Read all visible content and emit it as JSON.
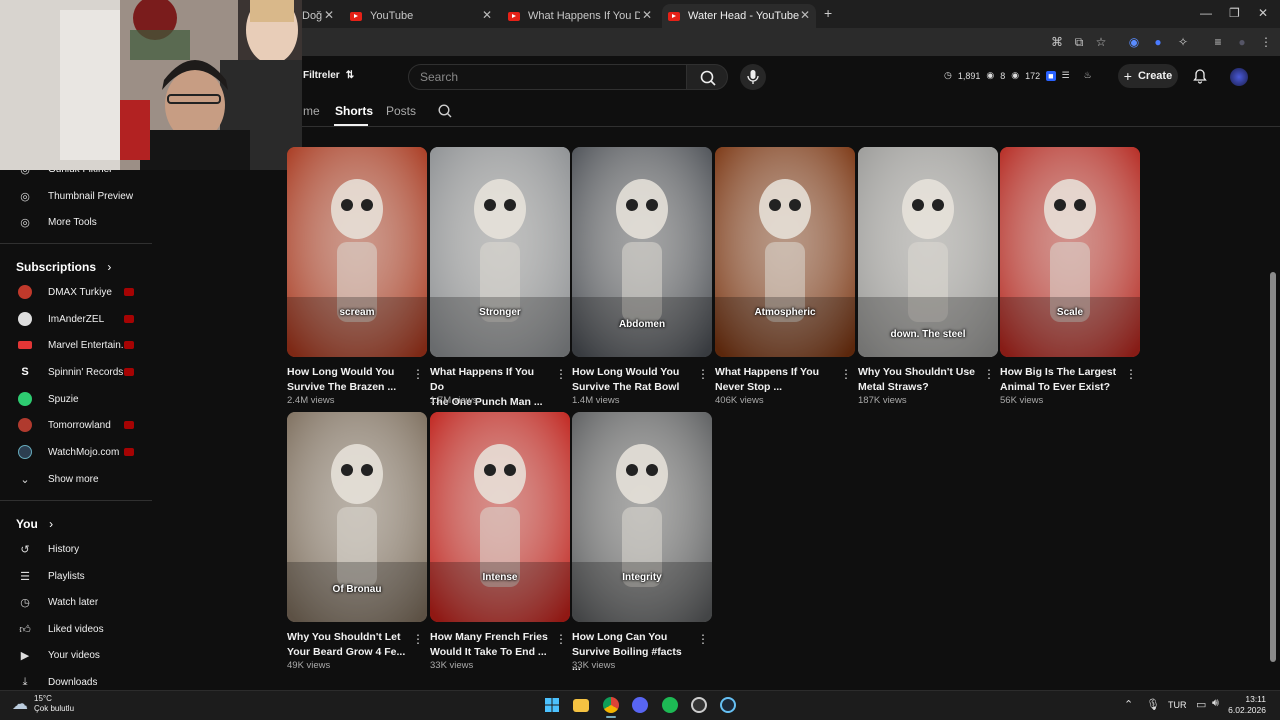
{
  "browser": {
    "tabs": [
      {
        "title": "Doğ",
        "active": false
      },
      {
        "title": "YouTube",
        "active": false
      },
      {
        "title": "What Happens If You Do The O",
        "active": false
      },
      {
        "title": "Water Head - YouTube",
        "active": true
      }
    ],
    "new_tab_icon": "plus-icon"
  },
  "header": {
    "filter_label": "Filtreler",
    "search_placeholder": "Search",
    "stats": {
      "a": "1,891",
      "b": "8",
      "c": "172"
    },
    "create_label": "Create"
  },
  "channel_tabs": [
    {
      "label": "me",
      "active": false
    },
    {
      "label": "Shorts",
      "active": true
    },
    {
      "label": "Posts",
      "active": false
    }
  ],
  "sidebar": {
    "tools": [
      {
        "label": "Günlük Fikirler",
        "icon": "tool-icon"
      },
      {
        "label": "Thumbnail Preview",
        "icon": "tool-icon"
      },
      {
        "label": "More Tools",
        "icon": "tool-icon"
      }
    ],
    "subscriptions_title": "Subscriptions",
    "subscriptions": [
      {
        "label": "DMAX Turkiye",
        "color": "#c0392b"
      },
      {
        "label": "ImAnderZEL",
        "color": "#dddddd"
      },
      {
        "label": "Marvel Entertain...",
        "color": "#e23636"
      },
      {
        "label": "Spinnin' Records",
        "color": "#ffffff"
      },
      {
        "label": "Spuzie",
        "color": "#2ecc71"
      },
      {
        "label": "Tomorrowland",
        "color": "#b03a2e"
      },
      {
        "label": "WatchMojo.com",
        "color": "#2c3e50"
      }
    ],
    "show_more": "Show more",
    "you_title": "You",
    "you_items": [
      {
        "label": "History",
        "icon": "history-icon"
      },
      {
        "label": "Playlists",
        "icon": "playlists-icon"
      },
      {
        "label": "Watch later",
        "icon": "clock-icon"
      },
      {
        "label": "Liked videos",
        "icon": "thumbs-up-icon"
      },
      {
        "label": "Your videos",
        "icon": "play-square-icon"
      },
      {
        "label": "Downloads",
        "icon": "download-icon"
      }
    ]
  },
  "shorts": [
    {
      "title1": "How Long Would You",
      "title2": "Survive The Brazen ...",
      "views": "2.4M views",
      "caption": "scream",
      "bg": "#a8361c"
    },
    {
      "title1": "What Happens If You Do",
      "title2": "The One Punch Man ...",
      "views": "1.7M views",
      "caption": "Stronger",
      "bg": "#8c8f92"
    },
    {
      "title1": "How Long Would You",
      "title2": "Survive The Rat Bowl",
      "views": "1.4M views",
      "caption": "Abdomen",
      "bg": "#4b4f55"
    },
    {
      "title1": "What Happens If You",
      "title2": "Never Stop ...",
      "views": "406K views",
      "caption": "Atmospheric",
      "bg": "#7a3410"
    },
    {
      "title1": "Why You Shouldn't Use",
      "title2": "Metal Straws?",
      "views": "187K views",
      "caption": "down. The steel",
      "bg": "#9a9a98"
    },
    {
      "title1": "How Big Is The Largest",
      "title2": "Animal To Ever Exist?",
      "views": "56K views",
      "caption": "Scale",
      "bg": "#b5261e"
    },
    {
      "title1": "Why You Shouldn't Let",
      "title2": "Your Beard Grow 4 Fe...",
      "views": "49K views",
      "caption": "Of Bronau",
      "bg": "#7c6d5c"
    },
    {
      "title1": "How Many French Fries",
      "title2": "Would It Take To End ...",
      "views": "33K views",
      "caption": "Intense",
      "bg": "#c0201a"
    },
    {
      "title1": "How Long Can You",
      "title2": "Survive Boiling #facts ...",
      "views": "33K views",
      "caption": "Integrity",
      "bg": "#5a5c5e"
    }
  ],
  "taskbar": {
    "weather_temp": "15°C",
    "weather_desc": "Çok bulutlu",
    "lang": "TUR",
    "time": "13:11",
    "date": "6.02.2026"
  }
}
